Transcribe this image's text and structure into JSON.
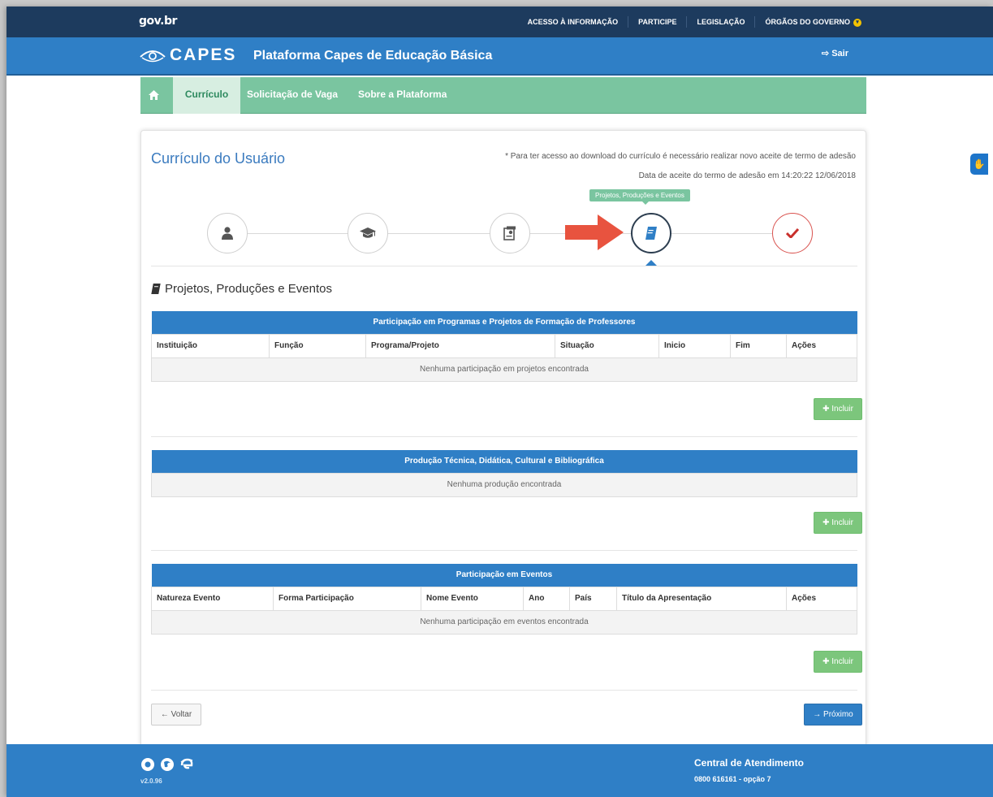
{
  "gov": {
    "logo": "gov.br",
    "links": [
      "ACESSO À INFORMAÇÃO",
      "PARTICIPE",
      "LEGISLAÇÃO",
      "ÓRGÃOS DO GOVERNO"
    ]
  },
  "header": {
    "brand": "CAPES",
    "title": "Plataforma Capes de Educação Básica",
    "logout": "Sair"
  },
  "nav": {
    "items": [
      "Currículo",
      "Solicitação de Vaga",
      "Sobre a Plataforma"
    ]
  },
  "page": {
    "title": "Currículo do Usuário",
    "notice": "* Para ter acesso ao download do currículo é necessário realizar novo aceite de termo de adesão",
    "accept_date": "Data de aceite do termo de adesão em 14:20:22 12/06/2018"
  },
  "stepper": {
    "tooltip": "Projetos, Produções e Eventos",
    "active_step": 4,
    "steps": [
      "user-icon",
      "graduation-cap-icon",
      "certificate-icon",
      "book-icon",
      "check-icon"
    ]
  },
  "section": {
    "heading": "Projetos, Produções e Eventos"
  },
  "tables": {
    "projetos": {
      "title": "Participação em Programas e Projetos de Formação de Professores",
      "columns": [
        "Instituição",
        "Função",
        "Programa/Projeto",
        "Situação",
        "Inicio",
        "Fim",
        "Ações"
      ],
      "empty": "Nenhuma participação em projetos encontrada"
    },
    "producao": {
      "title": "Produção Técnica, Didática, Cultural e Bibliográfica",
      "empty": "Nenhuma produção encontrada"
    },
    "eventos": {
      "title": "Participação em Eventos",
      "columns": [
        "Natureza Evento",
        "Forma Participação",
        "Nome Evento",
        "Ano",
        "País",
        "Título da Apresentação",
        "Ações"
      ],
      "empty": "Nenhuma participação em eventos encontrada"
    }
  },
  "buttons": {
    "incluir": "Incluir",
    "voltar": "Voltar",
    "proximo": "Próximo"
  },
  "footer": {
    "version": "v2.0.96",
    "central": "Central de Atendimento",
    "phone": "0800 616161 - opção 7"
  },
  "colors": {
    "gov_bar": "#1d3b5e",
    "brand_blue": "#2f7fc6",
    "nav_green": "#7ac5a0",
    "arrow_red": "#e8533f"
  }
}
